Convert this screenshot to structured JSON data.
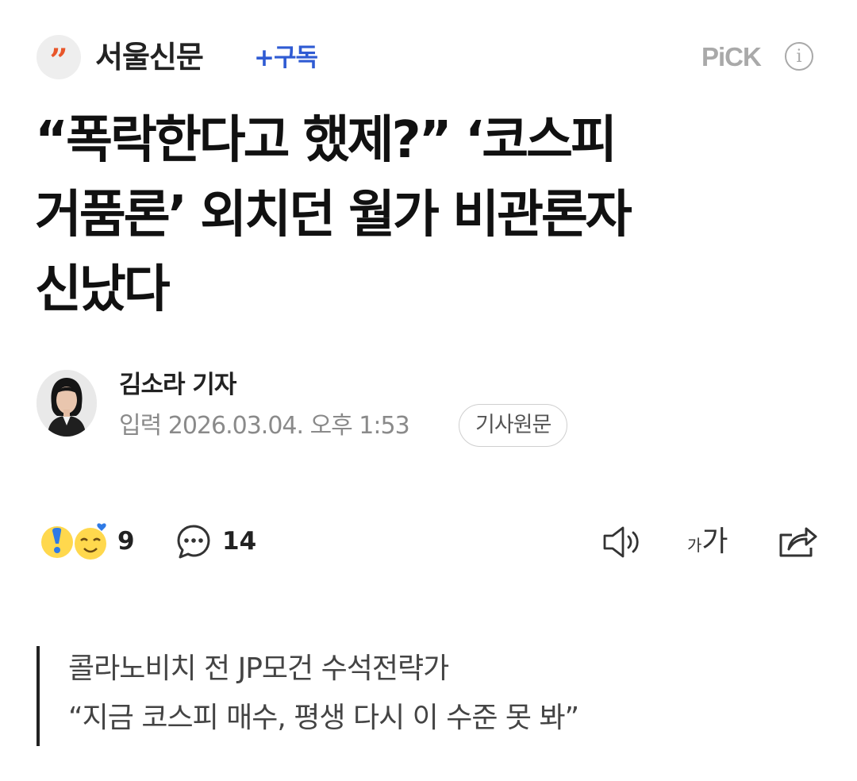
{
  "header": {
    "logo_glyph": "”",
    "press_name": "서울신문",
    "subscribe_label": "+구독",
    "pick_label": "PiCK",
    "info_icon": "info-icon"
  },
  "article": {
    "headline_lines": [
      "“폭락한다고 했제?” ‘코스피",
      "거품론’ 외치던 월가 비관론자",
      "신났다"
    ],
    "reporter": "김소라 기자",
    "dateline": "입력 2026.03.04. 오후 1:53",
    "original_link_label": "기사원문"
  },
  "actions": {
    "reaction_count": "9",
    "comment_count": "14",
    "tts_icon": "speaker-icon",
    "font_small": "가",
    "font_big": "가",
    "share_icon": "share-icon"
  },
  "subheads": [
    "콜라노비치 전 JP모건 수석전략가",
    "“지금 코스피 매수, 평생 다시 이 수준 못 봐”"
  ],
  "colors": {
    "subscribe": "#2f5bd3",
    "logo_accent": "#e8562a",
    "muted": "#8a8a8a"
  }
}
